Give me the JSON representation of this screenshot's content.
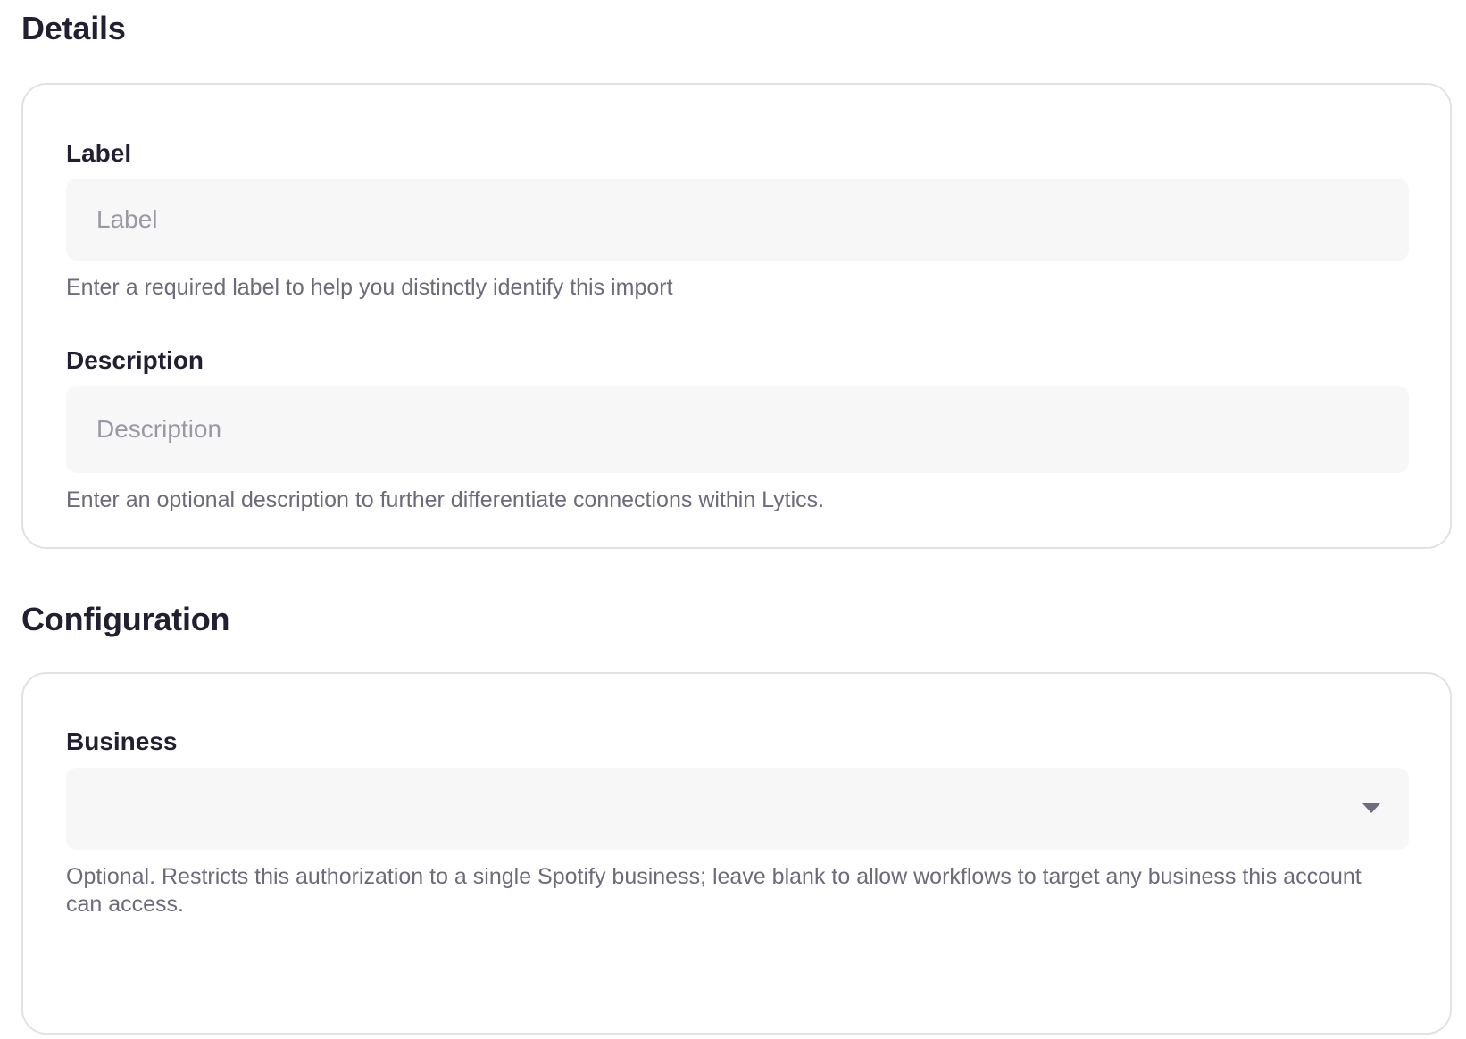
{
  "details": {
    "title": "Details",
    "label_field": {
      "label": "Label",
      "placeholder": "Label",
      "value": "",
      "helper": "Enter a required label to help you distinctly identify this import"
    },
    "description_field": {
      "label": "Description",
      "placeholder": "Description",
      "value": "",
      "helper": "Enter an optional description to further differentiate connections within Lytics."
    }
  },
  "configuration": {
    "title": "Configuration",
    "business_field": {
      "label": "Business",
      "selected": "",
      "helper": "Optional. Restricts this authorization to a single Spotify business; leave blank to allow workflows to target any business this account can access."
    }
  },
  "icons": {
    "dropdown": "chevron-down-icon"
  },
  "colors": {
    "text_primary": "#231f33",
    "text_helper": "#6c6a7b",
    "input_background": "#f7f7f8",
    "card_border": "#e2e2e6"
  }
}
